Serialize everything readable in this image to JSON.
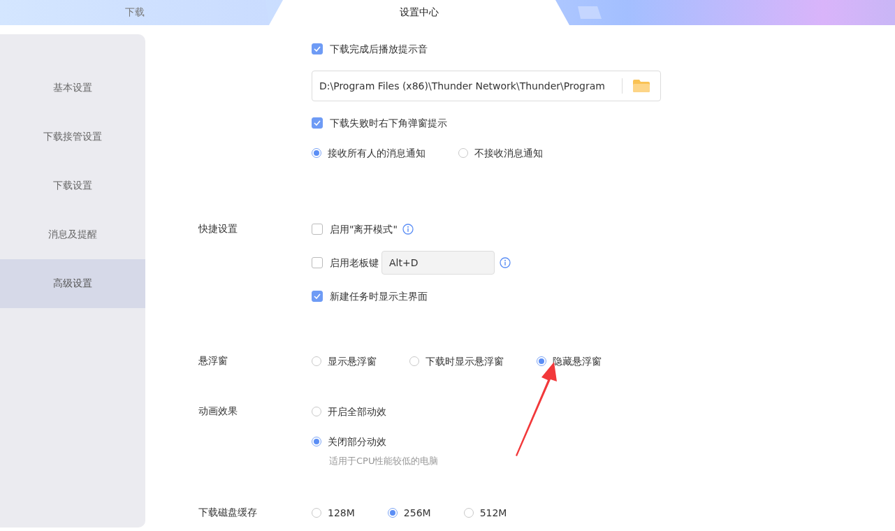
{
  "tabs": [
    {
      "label": "下载",
      "selected": false
    },
    {
      "label": "设置中心",
      "selected": true
    }
  ],
  "sidebar": {
    "items": [
      {
        "label": "基本设置",
        "selected": false
      },
      {
        "label": "下载接管设置",
        "selected": false
      },
      {
        "label": "下载设置",
        "selected": false
      },
      {
        "label": "消息及提醒",
        "selected": false
      },
      {
        "label": "高级设置",
        "selected": true
      }
    ]
  },
  "sections": [
    {
      "rows": [
        {
          "kind": "checkbox",
          "label": "下载完成后播放提示音",
          "checked": true
        },
        {
          "kind": "path",
          "value": "D:\\Program Files (x86)\\Thunder Network\\Thunder\\Program"
        },
        {
          "kind": "checkbox",
          "label": "下载失败时右下角弹窗提示",
          "checked": true
        },
        {
          "kind": "radios",
          "options": [
            {
              "label": "接收所有人的消息通知",
              "selected": true
            },
            {
              "label": "不接收消息通知",
              "selected": false
            }
          ]
        }
      ]
    },
    {
      "label": "快捷设置",
      "rows": [
        {
          "kind": "checkbox",
          "label": "启用\"离开模式\"",
          "checked": false,
          "info": true
        },
        {
          "kind": "hotkey",
          "label": "启用老板键",
          "checked": false,
          "value": "Alt+D",
          "info": true
        },
        {
          "kind": "checkbox",
          "label": "新建任务时显示主界面",
          "checked": true
        }
      ]
    },
    {
      "label": "悬浮窗",
      "rows": [
        {
          "kind": "radios",
          "options": [
            {
              "label": "显示悬浮窗",
              "selected": false
            },
            {
              "label": "下载时显示悬浮窗",
              "selected": false
            },
            {
              "label": "隐藏悬浮窗",
              "selected": true
            }
          ]
        }
      ]
    },
    {
      "label": "动画效果",
      "rows": [
        {
          "kind": "radios",
          "options": [
            {
              "label": "开启全部动效",
              "selected": false
            }
          ]
        },
        {
          "kind": "radios",
          "options": [
            {
              "label": "关闭部分动效",
              "selected": true
            }
          ]
        },
        {
          "kind": "hint",
          "text": "适用于CPU性能较低的电脑"
        }
      ]
    },
    {
      "label": "下载磁盘缓存",
      "rows": [
        {
          "kind": "radios",
          "options": [
            {
              "label": "128M",
              "selected": false
            },
            {
              "label": "256M",
              "selected": true
            },
            {
              "label": "512M",
              "selected": false
            }
          ]
        }
      ]
    }
  ]
}
